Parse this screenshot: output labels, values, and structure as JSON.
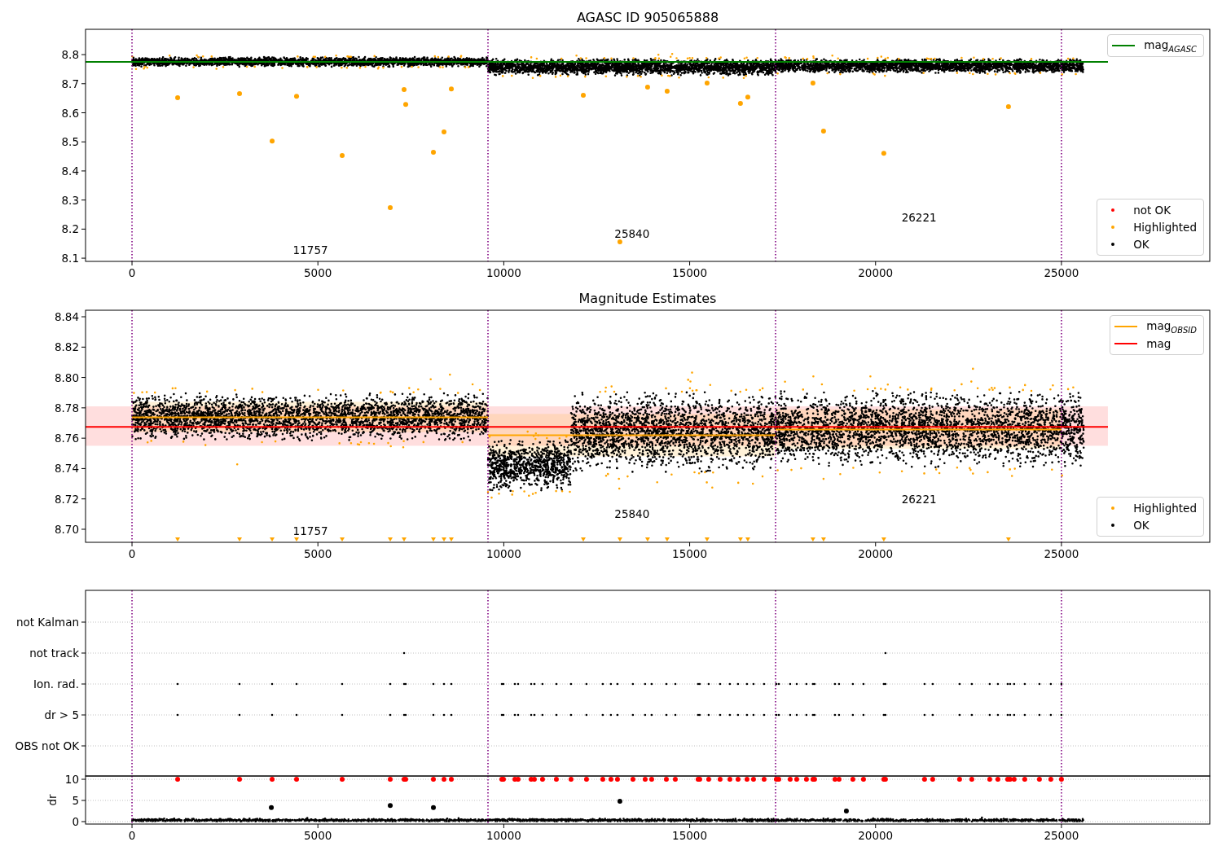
{
  "figure": {
    "panels": [
      {
        "kind": "magnitude",
        "legends": [
          {
            "entries": [
              {
                "kind": "line",
                "label": "mag$_{AGASC}$",
                "color": "#008000"
              }
            ]
          },
          {
            "entries": [
              {
                "kind": "dot",
                "label": "not OK",
                "color": "#ff0000"
              },
              {
                "kind": "dot",
                "label": "Highlighted",
                "color": "#ffa500"
              },
              {
                "kind": "dot",
                "label": "OK",
                "color": "#000000"
              }
            ]
          }
        ],
        "chart_data": {
          "type": "scatter",
          "title": "AGASC ID 905065888",
          "xlim": [
            -1250,
            28990
          ],
          "ylim": [
            8.089,
            8.887
          ],
          "xticks": [
            {
              "value": 0,
              "label": "0"
            },
            {
              "value": 5000,
              "label": "5000"
            },
            {
              "value": 10000,
              "label": "10000"
            },
            {
              "value": 15000,
              "label": "15000"
            },
            {
              "value": 20000,
              "label": "20000"
            },
            {
              "value": 25000,
              "label": "25000"
            }
          ],
          "yticks": [
            {
              "value": 8.1,
              "label": "8.1"
            },
            {
              "value": 8.2,
              "label": "8.2"
            },
            {
              "value": 8.3,
              "label": "8.3"
            },
            {
              "value": 8.4,
              "label": "8.4"
            },
            {
              "value": 8.5,
              "label": "8.5"
            },
            {
              "value": 8.6,
              "label": "8.6"
            },
            {
              "value": 8.7,
              "label": "8.7"
            },
            {
              "value": 8.8,
              "label": "8.8"
            }
          ],
          "ref_lines": [
            {
              "axis": "x",
              "value": 0,
              "color": "#800080"
            },
            {
              "axis": "x",
              "value": 9575,
              "color": "#800080"
            },
            {
              "axis": "x",
              "value": 17310,
              "color": "#800080"
            },
            {
              "axis": "x",
              "value": 25000,
              "color": "#800080"
            }
          ],
          "series": [
            {
              "type": "line",
              "color": "#008000",
              "x": [
                -1250,
                26250
              ],
              "values": [
                8.775,
                8.775
              ]
            },
            {
              "type": "scatter",
              "color": "#ffa500",
              "x": [
                1227,
                2892,
                3769,
                4426,
                5653,
                6946,
                7318,
                7362,
                8107,
                8392,
                8589,
                12139,
                13124,
                13868,
                14394,
                15468,
                16366,
                16564,
                18316,
                18601,
                20222,
                23575
              ],
              "values": [
                8.652,
                8.666,
                8.503,
                8.657,
                8.453,
                8.274,
                8.68,
                8.629,
                8.464,
                8.534,
                8.682,
                8.66,
                8.156,
                8.688,
                8.674,
                8.702,
                8.632,
                8.654,
                8.702,
                8.537,
                8.461,
                8.621
              ]
            }
          ],
          "annotations": [
            "11757",
            "25840",
            "26221"
          ]
        }
      },
      {
        "kind": "magnitude",
        "legends": [
          {
            "entries": [
              {
                "kind": "line",
                "label": "mag$_{OBSID}$",
                "color": "#ffa500"
              },
              {
                "kind": "line",
                "label": "mag",
                "color": "#ff0000"
              }
            ]
          },
          {
            "entries": [
              {
                "kind": "dot",
                "label": "Highlighted",
                "color": "#ffa500"
              },
              {
                "kind": "dot",
                "label": "OK",
                "color": "#000000"
              }
            ]
          }
        ],
        "chart_data": {
          "type": "scatter",
          "title": "Magnitude Estimates",
          "xlim": [
            -1250,
            28990
          ],
          "ylim": [
            8.6914,
            8.8443
          ],
          "xticks": [
            {
              "value": 0,
              "label": "0"
            },
            {
              "value": 5000,
              "label": "5000"
            },
            {
              "value": 10000,
              "label": "10000"
            },
            {
              "value": 15000,
              "label": "15000"
            },
            {
              "value": 20000,
              "label": "20000"
            },
            {
              "value": 25000,
              "label": "25000"
            }
          ],
          "yticks": [
            {
              "value": 8.7,
              "label": "8.70"
            },
            {
              "value": 8.72,
              "label": "8.72"
            },
            {
              "value": 8.74,
              "label": "8.74"
            },
            {
              "value": 8.76,
              "label": "8.76"
            },
            {
              "value": 8.78,
              "label": "8.78"
            },
            {
              "value": 8.8,
              "label": "8.80"
            },
            {
              "value": 8.82,
              "label": "8.82"
            },
            {
              "value": 8.84,
              "label": "8.84"
            }
          ],
          "ref_lines": [
            {
              "axis": "x",
              "value": 0,
              "color": "#800080"
            },
            {
              "axis": "x",
              "value": 9575,
              "color": "#800080"
            },
            {
              "axis": "x",
              "value": 17310,
              "color": "#800080"
            },
            {
              "axis": "x",
              "value": 25000,
              "color": "#800080"
            }
          ],
          "bands": [
            {
              "axis": "y",
              "from": 8.755,
              "to": 8.781,
              "color": "#ff0000"
            }
          ],
          "series": [
            {
              "type": "line",
              "color": "#ffa500",
              "x": [
                0,
                9575,
                null,
                9575,
                17310,
                null,
                17310,
                25000
              ],
              "values": [
                8.7737,
                8.7737,
                null,
                8.762,
                8.762,
                null,
                8.7657,
                8.7657
              ]
            },
            {
              "type": "line",
              "color": "#ff0000",
              "x": [
                -1250,
                26250
              ],
              "values": [
                8.7675,
                8.7675
              ]
            },
            {
              "type": "scatter",
              "marker": "triangle",
              "color": "#ffa500",
              "x": [
                1227,
                2892,
                3769,
                4426,
                5653,
                6946,
                7318,
                8107,
                8392,
                8589,
                12139,
                13124,
                13868,
                14394,
                15468,
                16366,
                16564,
                18316,
                18601,
                20222,
                23575
              ],
              "values": [
                8.693,
                8.693,
                8.693,
                8.693,
                8.693,
                8.693,
                8.693,
                8.693,
                8.693,
                8.693,
                8.693,
                8.693,
                8.693,
                8.693,
                8.693,
                8.693,
                8.693,
                8.693,
                8.693,
                8.693,
                8.693
              ]
            }
          ],
          "annotations": [
            "11757",
            "25840",
            "26221"
          ]
        }
      },
      {
        "kind": "flags",
        "rows": [
          {
            "label": "not Kalman"
          },
          {
            "label": "not track"
          },
          {
            "label": "Ion. rad."
          },
          {
            "label": "dr > 5"
          },
          {
            "label": "OBS not OK"
          }
        ]
      },
      {
        "kind": "dr",
        "chart_data": {
          "type": "scatter",
          "ylabel": "dr",
          "xlim": [
            -1250,
            28990
          ],
          "ylim": [
            -0.58,
            10.77
          ],
          "grid": true,
          "xticks": [
            {
              "value": 0,
              "label": "0"
            },
            {
              "value": 5000,
              "label": "5000"
            },
            {
              "value": 10000,
              "label": "10000"
            },
            {
              "value": 15000,
              "label": "15000"
            },
            {
              "value": 20000,
              "label": "20000"
            },
            {
              "value": 25000,
              "label": "25000"
            }
          ],
          "yticks": [
            {
              "value": 0,
              "label": "0"
            },
            {
              "value": 5,
              "label": "5"
            },
            {
              "value": 10,
              "label": "10"
            }
          ],
          "ref_lines": [
            {
              "axis": "x",
              "value": 0,
              "color": "#800080"
            },
            {
              "axis": "x",
              "value": 9575,
              "color": "#800080"
            },
            {
              "axis": "x",
              "value": 17310,
              "color": "#800080"
            },
            {
              "axis": "x",
              "value": 25000,
              "color": "#800080"
            }
          ],
          "series": [
            {
              "type": "scatter",
              "color": "#ff0000",
              "x": [
                1227,
                2892,
                3769,
                4426,
                5653,
                6946,
                7318,
                7362,
                8107,
                8392,
                8589,
                9947,
                9991,
                10298,
                10385,
                10736,
                10823,
                11042,
                11415,
                11809,
                12225,
                12663,
                12882,
                13058,
                13474,
                13803,
                13978,
                14373,
                14614,
                15227,
                15271,
                15512,
                15819,
                16082,
                16301,
                16542,
                16717,
                17002,
                17331,
                17397,
                17703,
                17879,
                18141,
                18316,
                18360,
                18908,
                19018,
                19390,
                19675,
                20222,
                20266,
                21318,
                21537,
                22260,
                22589,
                23071,
                23290,
                23553,
                23619,
                23728,
                24013,
                24408,
                24714,
                25000
              ],
              "values": [
                10,
                10,
                10,
                10,
                10,
                10,
                10,
                10,
                10,
                10,
                10,
                10,
                10,
                10,
                10,
                10,
                10,
                10,
                10,
                10,
                10,
                10,
                10,
                10,
                10,
                10,
                10,
                10,
                10,
                10,
                10,
                10,
                10,
                10,
                10,
                10,
                10,
                10,
                10,
                10,
                10,
                10,
                10,
                10,
                10,
                10,
                10,
                10,
                10,
                10,
                10,
                10,
                10,
                10,
                10,
                10,
                10,
                10,
                10,
                10,
                10,
                10,
                10,
                10
              ]
            },
            {
              "type": "scatter",
              "color": "#000000",
              "x": [
                3747,
                6946,
                8107,
                13124,
                19215
              ],
              "values": [
                3.3,
                3.8,
                3.3,
                4.8,
                2.5
              ]
            }
          ]
        }
      }
    ]
  }
}
